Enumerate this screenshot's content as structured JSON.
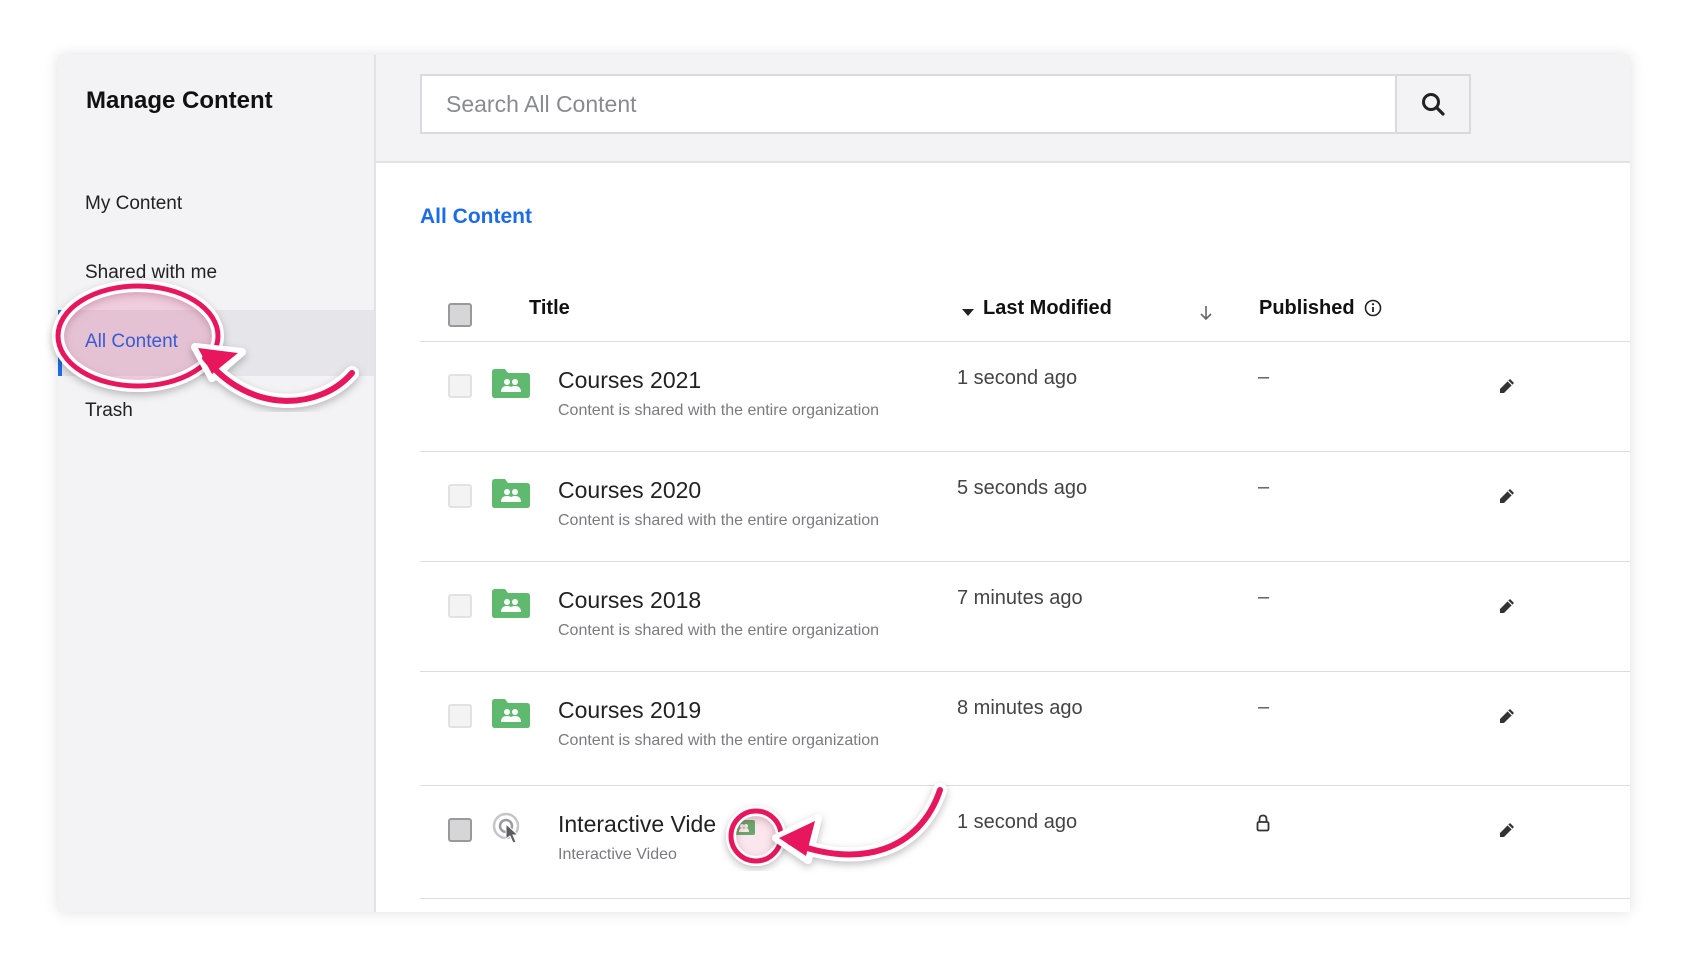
{
  "sidebar": {
    "title": "Manage Content",
    "items": [
      {
        "label": "My Content"
      },
      {
        "label": "Shared with me"
      },
      {
        "label": "All Content"
      },
      {
        "label": "Trash"
      }
    ]
  },
  "search": {
    "placeholder": "Search All Content"
  },
  "breadcrumb": "All Content",
  "table": {
    "headers": {
      "title": "Title",
      "last_modified": "Last Modified",
      "published": "Published"
    },
    "rows": [
      {
        "title": "Courses 2021",
        "subtitle": "Content is shared with the entire organization",
        "modified": "1 second ago",
        "published": "–",
        "icon": "shared-folder-icon"
      },
      {
        "title": "Courses 2020",
        "subtitle": "Content is shared with the entire organization",
        "modified": "5 seconds ago",
        "published": "–",
        "icon": "shared-folder-icon"
      },
      {
        "title": "Courses 2018",
        "subtitle": "Content is shared with the entire organization",
        "modified": "7 minutes ago",
        "published": "–",
        "icon": "shared-folder-icon"
      },
      {
        "title": "Courses 2019",
        "subtitle": "Content is shared with the entire organization",
        "modified": "8 minutes ago",
        "published": "–",
        "icon": "shared-folder-icon"
      },
      {
        "title": "Interactive Vide",
        "subtitle": "Interactive Video",
        "modified": "1 second ago",
        "published": "",
        "icon": "interactive-video-icon"
      }
    ]
  },
  "colors": {
    "accent": "#1c6ce8",
    "folder_green": "#5fb96f",
    "annotation_pink": "#e8175d"
  }
}
